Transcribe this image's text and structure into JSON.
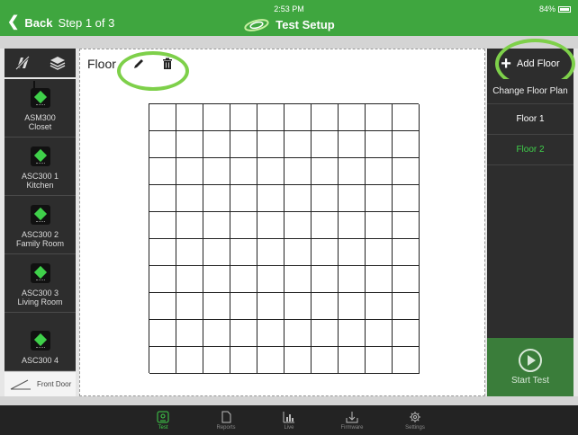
{
  "status": {
    "time": "2:53 PM",
    "battery": "84%"
  },
  "header": {
    "back_label": "Back",
    "step_label": "Step 1 of 3",
    "title": "Test Setup"
  },
  "canvas": {
    "floor_name": "Floor",
    "grid_rows": 10,
    "grid_cols": 10
  },
  "devices": [
    {
      "label": "ASM300\nCloset",
      "line1": "ASM300",
      "line2": "Closet",
      "icon": "sensor-antenna-icon"
    },
    {
      "line1": "ASC300 1",
      "line2": "Kitchen",
      "icon": "sensor-icon"
    },
    {
      "line1": "ASC300 2",
      "line2": "Family Room",
      "icon": "sensor-icon"
    },
    {
      "line1": "ASC300 3",
      "line2": "Living Room",
      "icon": "sensor-icon"
    },
    {
      "line1": "ASC300 4",
      "line2": "",
      "icon": "sensor-icon"
    }
  ],
  "front_door": {
    "label": "Front Door"
  },
  "right_panel": {
    "add_floor_label": "Add Floor",
    "change_plan_label": "Change Floor Plan",
    "floors": [
      "Floor 1",
      "Floor 2"
    ],
    "active_floor": "Floor 2",
    "start_test_label": "Start Test"
  },
  "tabs": [
    {
      "label": "Test",
      "icon": "test-icon",
      "active": true
    },
    {
      "label": "Reports",
      "icon": "reports-icon",
      "active": false
    },
    {
      "label": "Live",
      "icon": "live-icon",
      "active": false
    },
    {
      "label": "Firmware",
      "icon": "firmware-icon",
      "active": false
    },
    {
      "label": "Settings",
      "icon": "settings-icon",
      "active": false
    }
  ],
  "colors": {
    "header_green": "#3fa63f",
    "accent_green": "#3fd04a",
    "ring_green": "#7ed04a",
    "panel_dark": "#2d2d2d"
  }
}
